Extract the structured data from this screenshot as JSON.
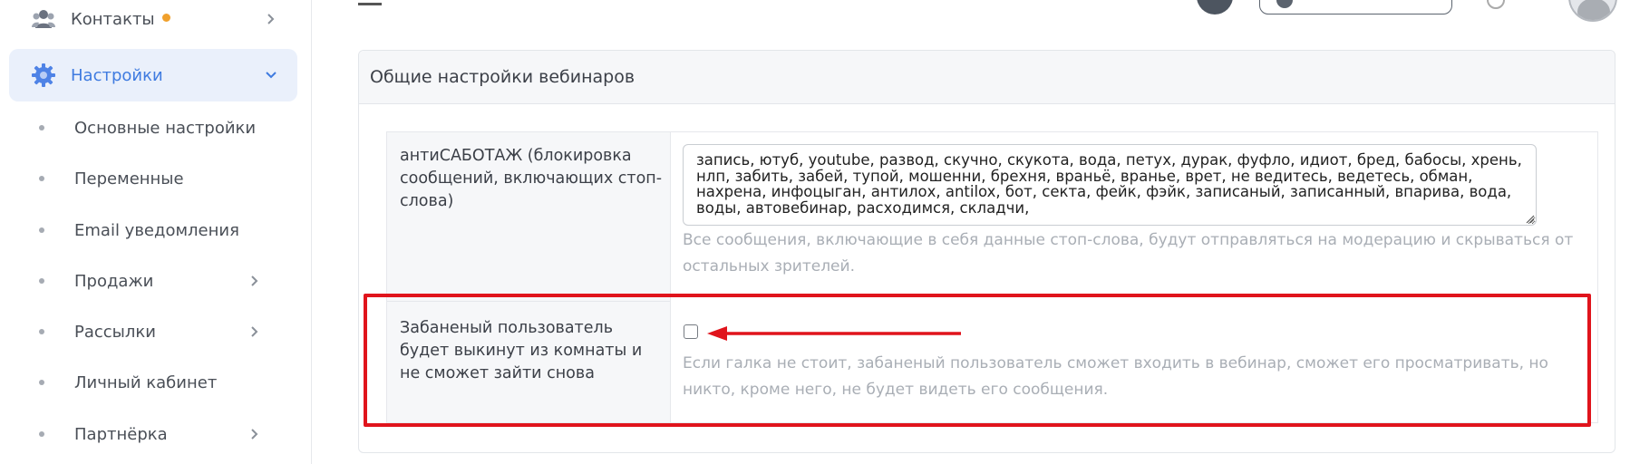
{
  "sidebar": {
    "items": [
      {
        "label": "Контакты",
        "icon": "users-icon",
        "badge": true
      },
      {
        "label": "Настройки",
        "icon": "gear-icon",
        "active": true
      }
    ],
    "subitems": [
      {
        "label": "Основные настройки"
      },
      {
        "label": "Переменные"
      },
      {
        "label": "Email уведомления"
      },
      {
        "label": "Продажи",
        "has_children": true
      },
      {
        "label": "Рассылки",
        "has_children": true
      },
      {
        "label": "Личный кабинет"
      },
      {
        "label": "Партнёрка",
        "has_children": true
      }
    ]
  },
  "panel": {
    "title": "Общие настройки вебинаров",
    "antisabotage": {
      "label": "антиСАБОТАЖ (блокировка сообщений, включающих стоп-слова)",
      "value": "запись, ютуб, youtube, развод, скучно, скукота, вода, петух, дурак, фуфло, идиот, бред, бабосы, хрень, нлп, забить, забей, тупой, мошенни, брехня, враньё, вранье, врет, не ведитесь, ведетесь, обман, нахрена, инфоцыган, антилох, antilox, бот, секта, фейк, фэйк, записаный, записанный, впарива, вода, воды, автовебинар, расходимся, складчи,",
      "help": "Все сообщения, включающие в себя данные стоп-слова, будут отправляться на модерацию и скрываться от остальных зрителей."
    },
    "ban_kick": {
      "label": "Забаненый пользователь будет выкинут из комнаты и не сможет зайти снова",
      "checked": false,
      "help": "Если галка не стоит, забаненый пользователь сможет входить в вебинар, сможет его просматривать, но никто, кроме него, не будет видеть его сообщения."
    }
  },
  "colors": {
    "accent": "#3f7be0",
    "active_bg": "#eaf0fb",
    "badge": "#f0a02c",
    "annotation": "#e0141c"
  }
}
